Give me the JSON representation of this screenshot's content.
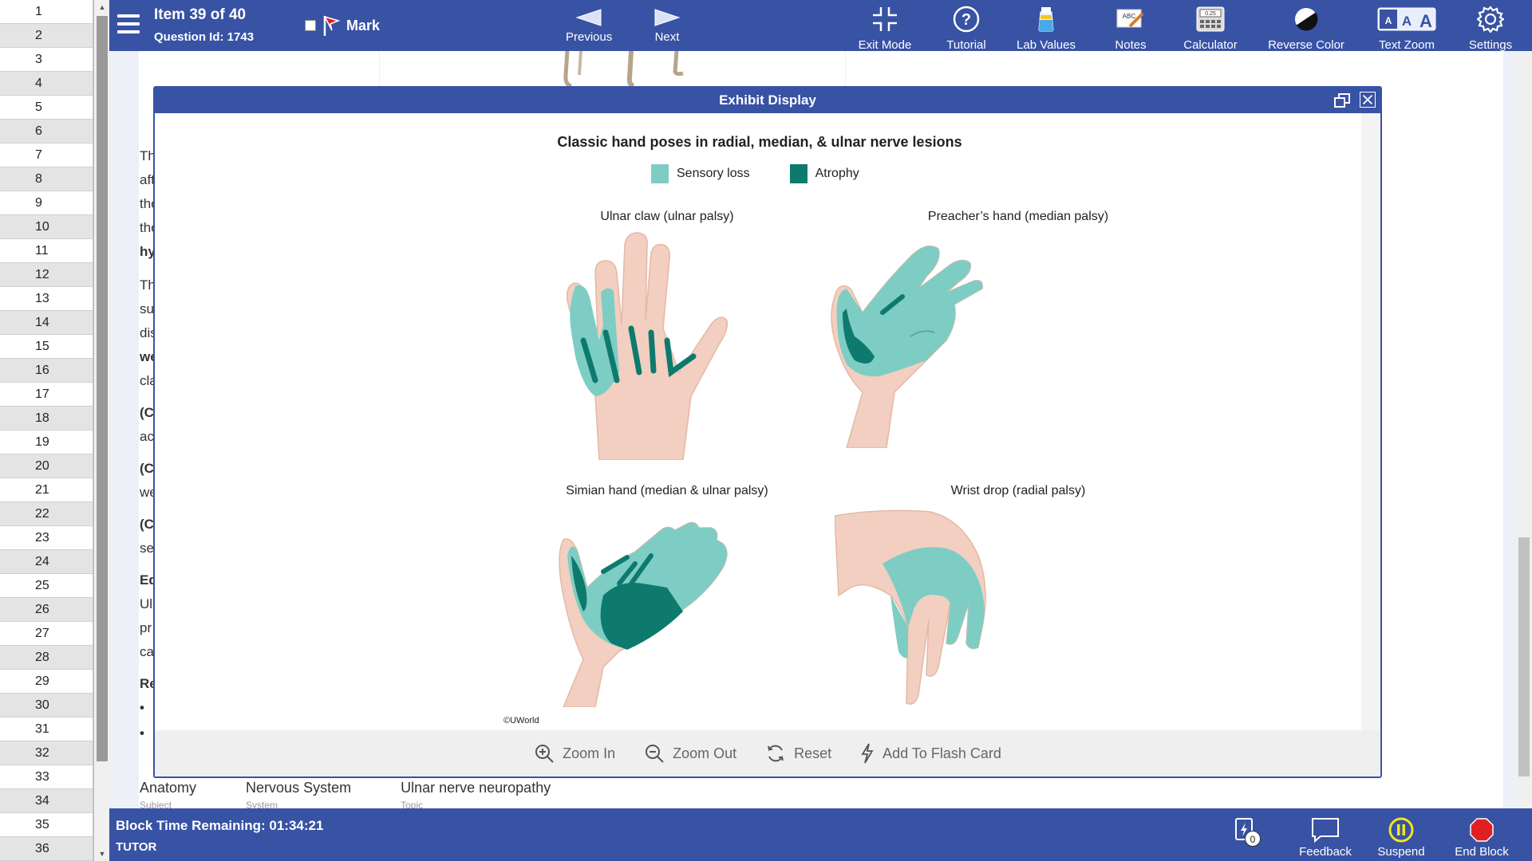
{
  "question_list": [
    "1",
    "2",
    "3",
    "4",
    "5",
    "6",
    "7",
    "8",
    "9",
    "10",
    "11",
    "12",
    "13",
    "14",
    "15",
    "16",
    "17",
    "18",
    "19",
    "20",
    "21",
    "22",
    "23",
    "24",
    "25",
    "26",
    "27",
    "28",
    "29",
    "30",
    "31",
    "32",
    "33",
    "34",
    "35",
    "36"
  ],
  "header": {
    "item_label": "Item 39 of 40",
    "question_id": "Question Id: 1743",
    "mark_label": "Mark",
    "previous_label": "Previous",
    "next_label": "Next",
    "tools": {
      "exit_mode": "Exit Mode",
      "tutorial": "Tutorial",
      "lab_values": "Lab Values",
      "notes": "Notes",
      "calculator": "Calculator",
      "reverse_color": "Reverse Color",
      "text_zoom": "Text Zoom",
      "settings": "Settings"
    }
  },
  "background_text": [
    {
      "text": "Th",
      "bold": false
    },
    {
      "text": "aft",
      "bold": false
    },
    {
      "text": "the",
      "bold": false
    },
    {
      "text": "the",
      "bold": false
    },
    {
      "text": "hy",
      "bold": true
    },
    {
      "text": "Th",
      "bold": false
    },
    {
      "text": "su",
      "bold": false
    },
    {
      "text": "dis",
      "bold": false
    },
    {
      "text": "we",
      "bold": true
    },
    {
      "text": "cla",
      "bold": false
    },
    {
      "text": "(C",
      "bold": true
    },
    {
      "text": "ac",
      "bold": false
    },
    {
      "text": "(C",
      "bold": true
    },
    {
      "text": "we",
      "bold": false
    },
    {
      "text": "(C",
      "bold": true
    },
    {
      "text": "se",
      "bold": false
    },
    {
      "text": "Ed",
      "bold": true
    },
    {
      "text": "Ul",
      "bold": false
    },
    {
      "text": "pr",
      "bold": false
    },
    {
      "text": "ca",
      "bold": false
    },
    {
      "text": "Re",
      "bold": true
    },
    {
      "text": "•",
      "bold": true
    },
    {
      "text": "•",
      "bold": true
    }
  ],
  "tags": [
    {
      "value": "Anatomy",
      "key": "Subject"
    },
    {
      "value": "Nervous System",
      "key": "System"
    },
    {
      "value": "Ulnar nerve neuropathy",
      "key": "Topic"
    }
  ],
  "exhibit": {
    "title": "Exhibit Display",
    "figure_title": "Classic hand poses in radial, median, & ulnar nerve lesions",
    "legend": [
      {
        "label": "Sensory loss",
        "color": "#7ecdc4"
      },
      {
        "label": "Atrophy",
        "color": "#0e7a6e"
      }
    ],
    "captions": {
      "ulnar": "Ulnar claw (ulnar palsy)",
      "preacher": "Preacher’s hand (median palsy)",
      "simian": "Simian hand (median & ulnar palsy)",
      "wrist": "Wrist drop (radial palsy)"
    },
    "copyright": "©UWorld",
    "footer": {
      "zoom_in": "Zoom In",
      "zoom_out": "Zoom Out",
      "reset": "Reset",
      "flash_card": "Add To Flash Card"
    }
  },
  "footer": {
    "timer": "Block Time Remaining: 01:34:21",
    "mode": "TUTOR",
    "flash_count": "0",
    "feedback": "Feedback",
    "suspend": "Suspend",
    "end_block": "End Block"
  },
  "colors": {
    "brand": "#3852a4",
    "skin": "#f2cfc0",
    "sensory": "#7ecdc4",
    "atrophy": "#0e7a6e",
    "suspend": "#f0e61e",
    "end_block": "#e02020"
  }
}
